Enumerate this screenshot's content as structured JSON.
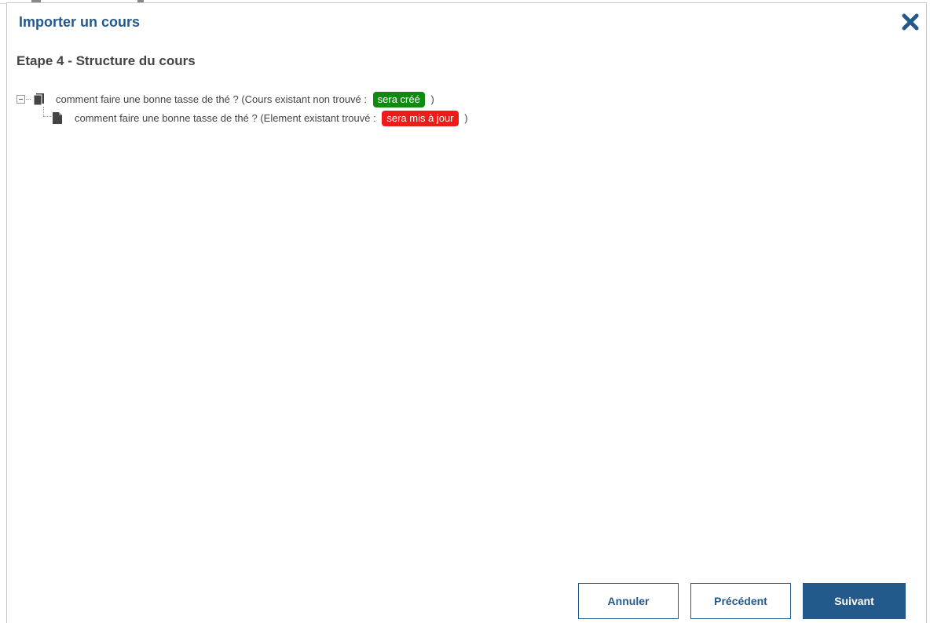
{
  "dialog": {
    "title": "Importer un cours",
    "close_icon": "close-x-icon",
    "accent_color": "#24598b"
  },
  "step": {
    "title": "Etape 4 - Structure du cours"
  },
  "tree": {
    "nodes": [
      {
        "icon": "book-icon",
        "text_prefix": "comment faire une bonne tasse de thé ? (Cours existant non trouvé :",
        "badge": "sera créé",
        "badge_color": "#118a11",
        "text_suffix": ")"
      },
      {
        "icon": "document-icon",
        "text_prefix": "comment faire une bonne tasse de thé ? (Element existant trouvé :",
        "badge": "sera mis à jour",
        "badge_color": "#ef1b1b",
        "text_suffix": ")"
      }
    ]
  },
  "footer": {
    "cancel_label": "Annuler",
    "previous_label": "Précédent",
    "next_label": "Suivant"
  }
}
